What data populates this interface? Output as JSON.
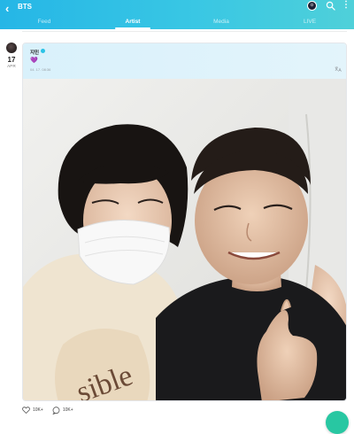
{
  "header": {
    "back_glyph": "‹",
    "title": "BTS",
    "cast_icon": "cast-icon",
    "search_icon": "search-icon",
    "more_icon": "more-icon",
    "tabs": [
      {
        "label": "Feed",
        "active": false
      },
      {
        "label": "Artist",
        "active": true
      },
      {
        "label": "Media",
        "active": false
      },
      {
        "label": "LIVE",
        "active": false
      }
    ]
  },
  "post": {
    "date_day": "17",
    "date_month": "APR",
    "author": "지민",
    "body": "💜",
    "timestamp": "04. 17. 08:36",
    "translate_icon": "translate-icon"
  },
  "actions": {
    "like_count": "10K+",
    "comment_count": "10K+"
  },
  "colors": {
    "header_gradient_start": "#25b6e6",
    "header_gradient_end": "#4fd0d9",
    "accent": "#2bc3e6",
    "fab": "#28c7a2"
  }
}
